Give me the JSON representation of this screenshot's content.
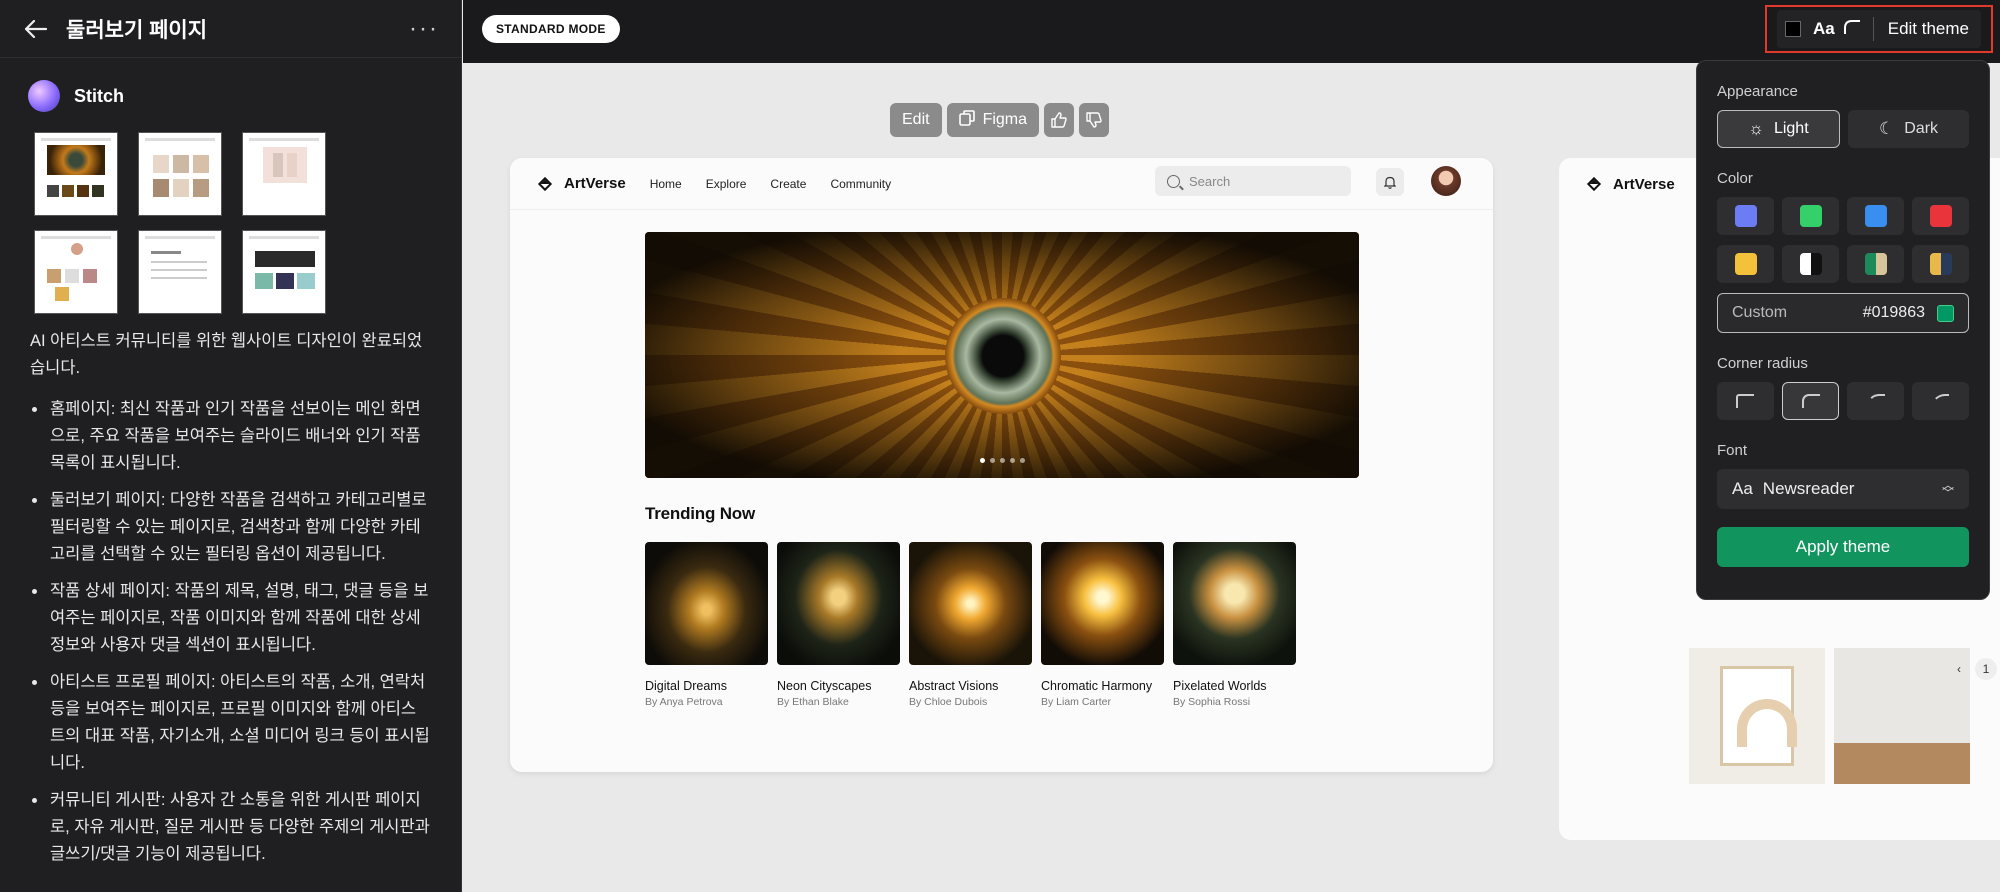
{
  "left_panel": {
    "title": "둘러보기 페이지",
    "more": "···",
    "agent_name": "Stitch",
    "intro": "AI 아티스트 커뮤니티를 위한 웹사이트 디자인이 완료되었습니다.",
    "bullets": [
      "홈페이지: 최신 작품과 인기 작품을 선보이는 메인 화면으로, 주요 작품을 보여주는 슬라이드 배너와 인기 작품 목록이 표시됩니다.",
      "둘러보기 페이지: 다양한 작품을 검색하고 카테고리별로 필터링할 수 있는 페이지로, 검색창과 함께 다양한 카테고리를 선택할 수 있는 필터링 옵션이 제공됩니다.",
      "작품 상세 페이지: 작품의 제목, 설명, 태그, 댓글 등을 보여주는 페이지로, 작품 이미지와 함께 작품에 대한 상세 정보와 사용자 댓글 섹션이 표시됩니다.",
      "아티스트 프로필 페이지: 아티스트의 작품, 소개, 연락처 등을 보여주는 페이지로, 프로필 이미지와 함께 아티스트의 대표 작품, 자기소개, 소셜 미디어 링크 등이 표시됩니다.",
      "커뮤니티 게시판: 사용자 간 소통을 위한 게시판 페이지로, 자유 게시판, 질문 게시판 등 다양한 주제의 게시판과 글쓰기/댓글 기능이 제공됩니다."
    ]
  },
  "topbar": {
    "mode": "STANDARD MODE",
    "theme_aa": "Aa",
    "edit_theme": "Edit theme"
  },
  "canvas_toolbar": {
    "edit": "Edit",
    "figma": "Figma"
  },
  "preview": {
    "brand": "ArtVerse",
    "nav": [
      "Home",
      "Explore",
      "Create",
      "Community"
    ],
    "search_placeholder": "Search",
    "trending_title": "Trending Now",
    "cards": [
      {
        "title": "Digital Dreams",
        "author": "By Anya Petrova"
      },
      {
        "title": "Neon Cityscapes",
        "author": "By Ethan Blake"
      },
      {
        "title": "Abstract Visions",
        "author": "By Chloe Dubois"
      },
      {
        "title": "Chromatic Harmony",
        "author": "By Liam Carter"
      },
      {
        "title": "Pixelated Worlds",
        "author": "By Sophia Rossi"
      }
    ],
    "second_brand": "ArtVerse",
    "page_number": "1"
  },
  "theme_popup": {
    "appearance_label": "Appearance",
    "light": "Light",
    "dark": "Dark",
    "color_label": "Color",
    "swatches": [
      "#6c7cf4",
      "#34d16a",
      "#3a8ef0",
      "#e8343a",
      "#f4c23a",
      "#ffffff",
      "#1e8a5a",
      "#e8b84a"
    ],
    "custom_label": "Custom",
    "custom_hex": "#019863",
    "corner_label": "Corner radius",
    "font_label": "Font",
    "font_aa": "Aa",
    "font_name": "Newsreader",
    "apply": "Apply theme"
  }
}
